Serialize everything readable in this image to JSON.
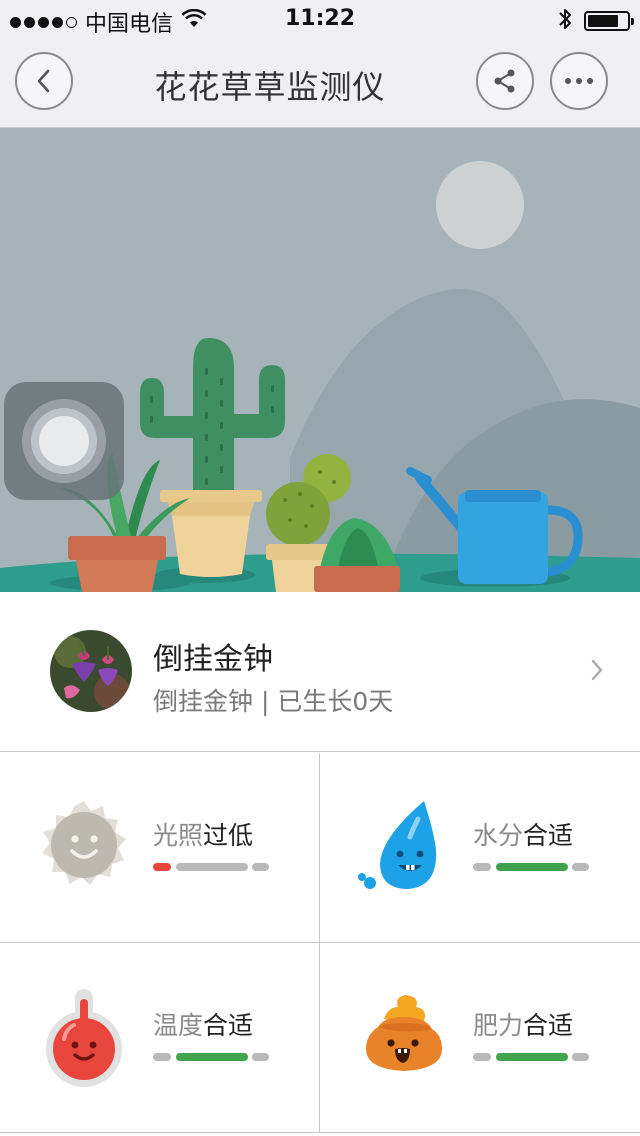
{
  "status_bar": {
    "carrier": "中国电信",
    "time": "11:22",
    "battery_level": 0.8
  },
  "nav": {
    "title": "花花草草监测仪",
    "back_icon": "chevron-left-icon",
    "share_icon": "share-icon",
    "more_icon": "more-dots-icon"
  },
  "plant": {
    "name": "倒挂金钟",
    "subtitle": "倒挂金钟 | 已生长0天"
  },
  "metrics": {
    "light": {
      "label": "光照",
      "status": "过低",
      "level": "low",
      "icon": "sun-icon",
      "active_color": "#e8453c"
    },
    "water": {
      "label": "水分",
      "status": "合适",
      "level": "ok",
      "icon": "water-drop-icon",
      "active_color": "#3fa34d"
    },
    "temperature": {
      "label": "温度",
      "status": "合适",
      "level": "ok",
      "icon": "thermometer-icon",
      "active_color": "#3fa34d"
    },
    "fertilizer": {
      "label": "肥力",
      "status": "合适",
      "level": "ok",
      "icon": "fertilizer-icon",
      "active_color": "#3fa34d"
    }
  },
  "colors": {
    "sky": "#a6b3b9",
    "ground": "#2f9d8e",
    "status_low": "#e8453c",
    "status_ok": "#3fa34d",
    "bar_inactive": "#b9b9b9"
  }
}
